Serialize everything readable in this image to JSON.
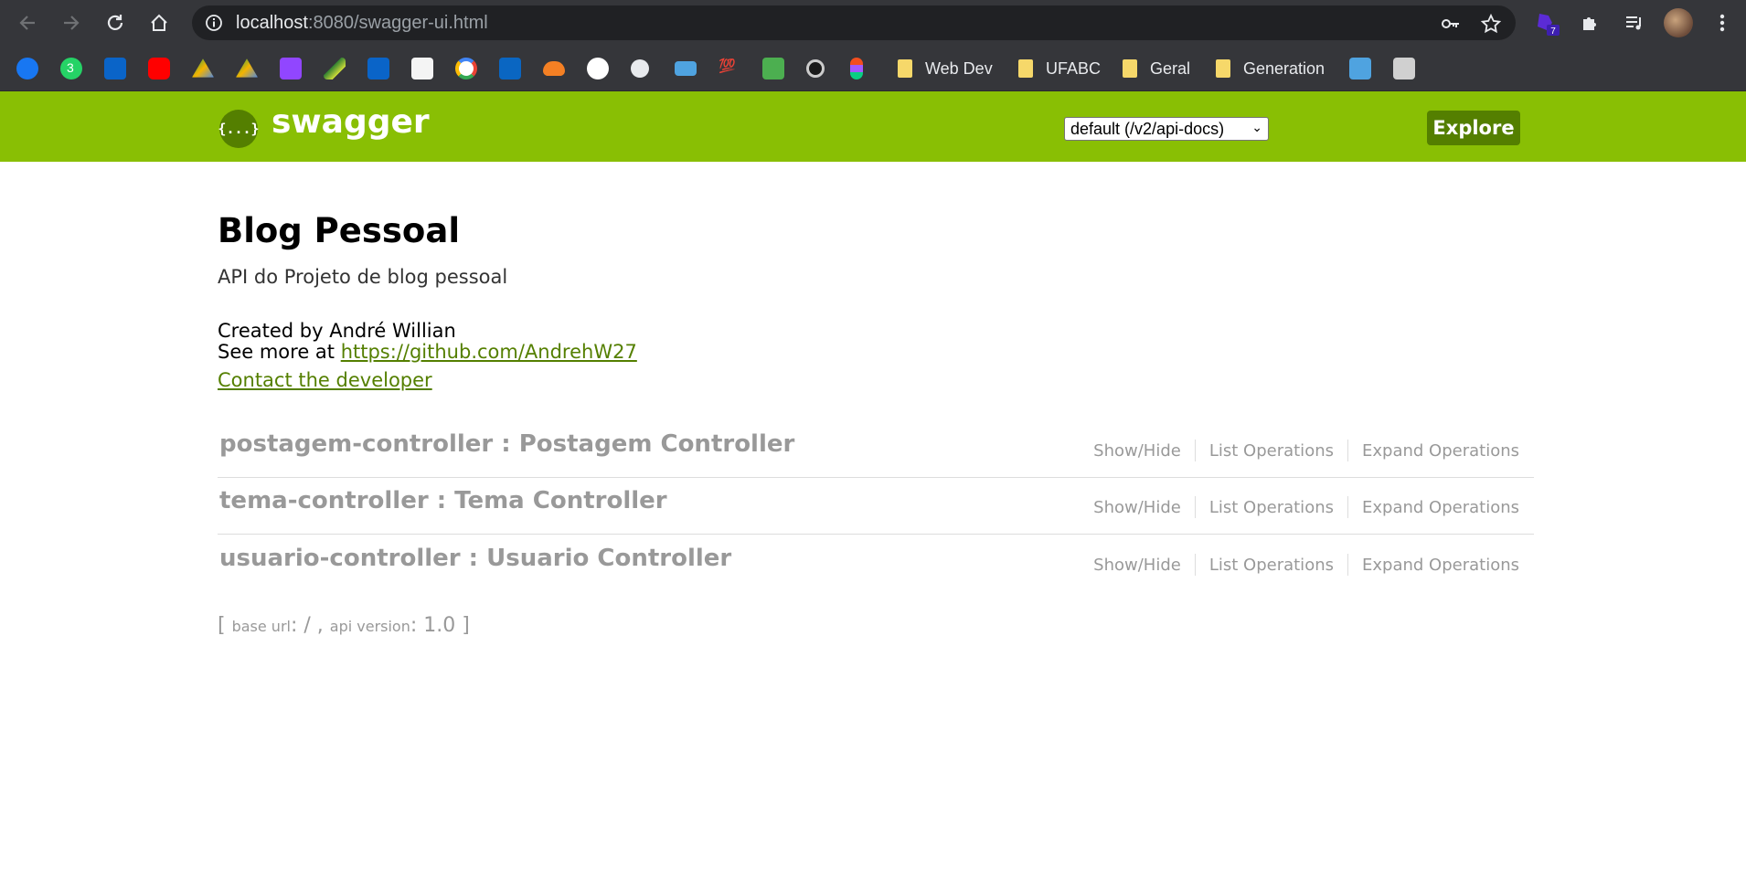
{
  "browser": {
    "url_host": "localhost",
    "url_path": ":8080/swagger-ui.html",
    "extension_badge": "7",
    "whatsapp_badge": "3",
    "bookmarks": [
      {
        "name": "facebook",
        "color": "#1877f2"
      },
      {
        "name": "whatsapp",
        "color": "#25d366"
      },
      {
        "name": "outlook",
        "color": "#0a64c8"
      },
      {
        "name": "youtube",
        "color": "#ff0000"
      },
      {
        "name": "drive",
        "color": "#f4b400"
      },
      {
        "name": "drive-2",
        "color": "#0f9d58"
      },
      {
        "name": "twitch",
        "color": "#9146ff"
      },
      {
        "name": "pen",
        "color": "#2e7d32"
      },
      {
        "name": "outlook-2",
        "color": "#0a64c8"
      },
      {
        "name": "photos",
        "color": "#f4f4f4"
      },
      {
        "name": "google",
        "color": "#ffffff"
      },
      {
        "name": "linkedin",
        "color": "#0a66c2"
      },
      {
        "name": "cloud",
        "color": "#f48024"
      },
      {
        "name": "github",
        "color": "#ffffff"
      },
      {
        "name": "globe",
        "color": "#e8eaed"
      },
      {
        "name": "laptop",
        "color": "#4fa3e0"
      },
      {
        "name": "hundred",
        "color": "#e53935"
      },
      {
        "name": "w3",
        "color": "#4caf50"
      },
      {
        "name": "openai",
        "color": "#cccccc"
      },
      {
        "name": "figma",
        "color": "#f24e1e"
      }
    ],
    "folders": [
      "Web Dev",
      "UFABC",
      "Geral",
      "Generation"
    ]
  },
  "swagger": {
    "logo_text": "swagger",
    "logo_glyph": "{...}",
    "spec_select": "default (/v2/api-docs)",
    "explore_label": "Explore"
  },
  "info": {
    "title": "Blog Pessoal",
    "description": "API do Projeto de blog pessoal",
    "created_by": "Created by André Willian",
    "see_more_prefix": "See more at ",
    "see_more_link": "https://github.com/AndrehW27",
    "contact": "Contact the developer"
  },
  "resources": [
    {
      "name": "postagem-controller : Postagem Controller"
    },
    {
      "name": "tema-controller : Tema Controller"
    },
    {
      "name": "usuario-controller : Usuario Controller"
    }
  ],
  "operations": {
    "show_hide": "Show/Hide",
    "list": "List Operations",
    "expand": "Expand Operations"
  },
  "footer": {
    "open": "[ ",
    "base_url_label": "base url",
    "base_url_value": ": / , ",
    "api_version_label": "api version",
    "api_version_value": ": 1.0 ]"
  }
}
